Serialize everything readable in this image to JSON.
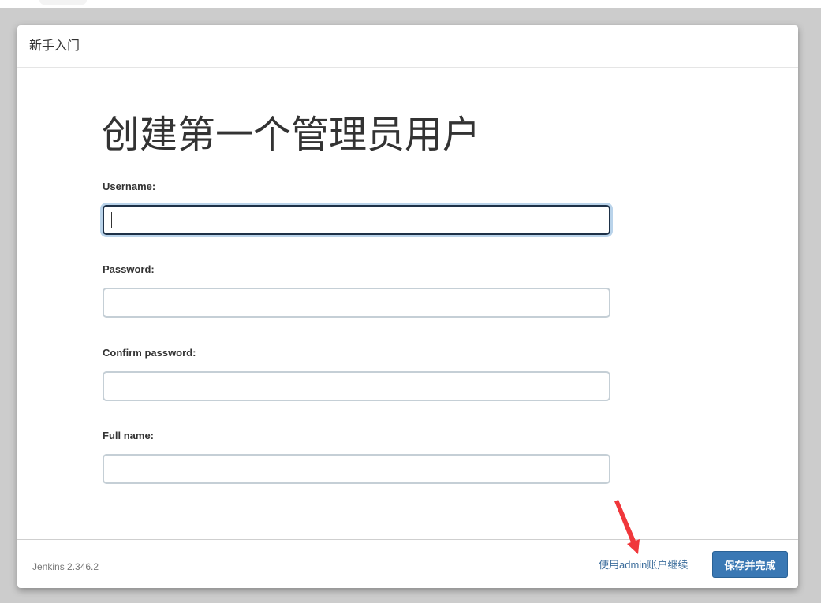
{
  "dialog": {
    "title": "新手入门"
  },
  "form": {
    "heading": "创建第一个管理员用户",
    "fields": [
      {
        "label": "Username:",
        "value": "",
        "focused": true
      },
      {
        "label": "Password:",
        "value": ""
      },
      {
        "label": "Confirm password:",
        "value": ""
      },
      {
        "label": "Full name:",
        "value": ""
      }
    ]
  },
  "footer": {
    "version": "Jenkins 2.346.2",
    "skip_link": "使用admin账户继续",
    "save_button": "保存并完成"
  },
  "colors": {
    "primary_button": "#3a78b4",
    "link": "#3d6e9c",
    "focus_ring": "#b9d3ea",
    "annotation_arrow": "#f0373b"
  },
  "annotation": {
    "icon": "red-arrow-icon"
  }
}
